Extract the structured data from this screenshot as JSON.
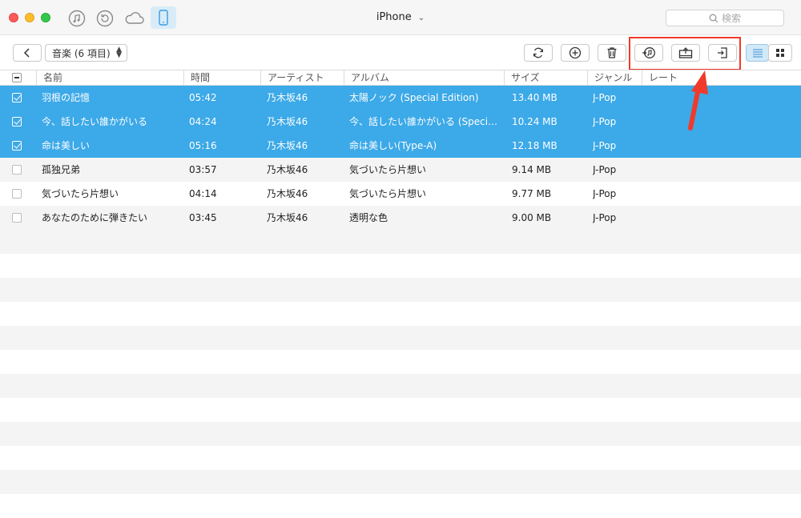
{
  "window": {
    "device_title": "iPhone",
    "search_placeholder": "検索"
  },
  "toolbar": {
    "category_label": "音楽 (6 項目)"
  },
  "table": {
    "columns": [
      "名前",
      "時間",
      "アーティスト",
      "アルバム",
      "サイズ",
      "ジャンル",
      "レート"
    ],
    "rows": [
      {
        "name": "羽根の記憶",
        "time": "05:42",
        "artist": "乃木坂46",
        "album": "太陽ノック (Special Edition)",
        "size": "13.40 MB",
        "genre": "J-Pop",
        "selected": true
      },
      {
        "name": "今、話したい誰かがいる",
        "time": "04:24",
        "artist": "乃木坂46",
        "album": "今、話したい誰かがいる (Special…",
        "size": "10.24 MB",
        "genre": "J-Pop",
        "selected": true
      },
      {
        "name": "命は美しい",
        "time": "05:16",
        "artist": "乃木坂46",
        "album": "命は美しい(Type-A)",
        "size": "12.18 MB",
        "genre": "J-Pop",
        "selected": true
      },
      {
        "name": "孤独兄弟",
        "time": "03:57",
        "artist": "乃木坂46",
        "album": "気づいたら片想い",
        "size": "9.14 MB",
        "genre": "J-Pop",
        "selected": false
      },
      {
        "name": "気づいたら片想い",
        "time": "04:14",
        "artist": "乃木坂46",
        "album": "気づいたら片想い",
        "size": "9.77 MB",
        "genre": "J-Pop",
        "selected": false
      },
      {
        "name": "あなたのために弾きたい",
        "time": "03:45",
        "artist": "乃木坂46",
        "album": "透明な色",
        "size": "9.00 MB",
        "genre": "J-Pop",
        "selected": false
      }
    ]
  },
  "colors": {
    "selection": "#3ca9e8",
    "annotation": "#f03a2b"
  }
}
